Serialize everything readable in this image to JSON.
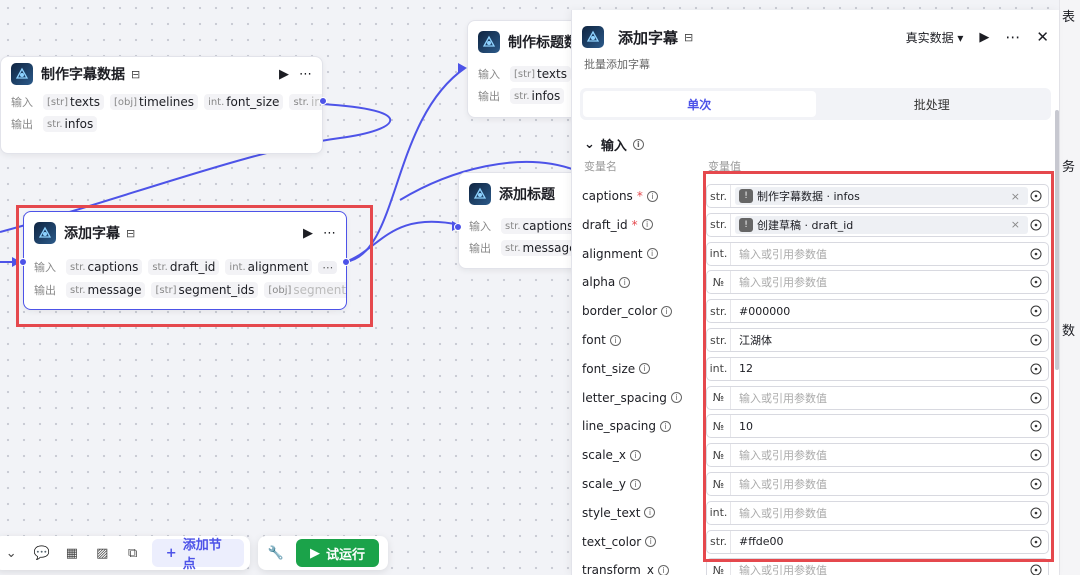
{
  "colors": {
    "accent": "#4d53e8",
    "run": "#1ba34a",
    "highlight": "#e5484d"
  },
  "nodes": {
    "make_subtitle": {
      "title": "制作字幕数据",
      "in_label": "输入",
      "out_label": "输出",
      "inputs": [
        {
          "type": "[str]",
          "name": "texts"
        },
        {
          "type": "[obj]",
          "name": "timelines"
        },
        {
          "type": "int.",
          "name": "font_size"
        },
        {
          "type": "str.",
          "name": "in"
        }
      ],
      "outputs": [
        {
          "type": "str.",
          "name": "infos"
        }
      ]
    },
    "add_subtitle": {
      "title": "添加字幕",
      "in_label": "输入",
      "out_label": "输出",
      "inputs": [
        {
          "type": "str.",
          "name": "captions"
        },
        {
          "type": "str.",
          "name": "draft_id"
        },
        {
          "type": "int.",
          "name": "alignment"
        }
      ],
      "outputs": [
        {
          "type": "str.",
          "name": "message"
        },
        {
          "type": "[str]",
          "name": "segment_ids"
        },
        {
          "type": "[obj]",
          "name": "segment"
        }
      ]
    },
    "make_title": {
      "title": "制作标题数",
      "in_label": "输入",
      "out_label": "输出",
      "inputs": [
        {
          "type": "[str]",
          "name": "texts"
        }
      ],
      "outputs": [
        {
          "type": "str.",
          "name": "infos"
        }
      ]
    },
    "add_title": {
      "title": "添加标题",
      "in_label": "输入",
      "out_label": "输出",
      "inputs": [
        {
          "type": "str.",
          "name": "captions"
        }
      ],
      "outputs": [
        {
          "type": "str.",
          "name": "message"
        }
      ]
    }
  },
  "toolbar": {
    "add_node": "添加节点",
    "test_run": "试运行"
  },
  "panel": {
    "title": "添加字幕",
    "subtitle": "批量添加字幕",
    "data_mode": "真实数据",
    "tabs": [
      {
        "label": "单次"
      },
      {
        "label": "批处理"
      }
    ],
    "section": "输入",
    "col_name": "变量名",
    "col_value": "变量值",
    "params": [
      {
        "name": "captions",
        "required": true,
        "type": "str.",
        "ref": true,
        "value": "制作字幕数据 · infos"
      },
      {
        "name": "draft_id",
        "required": true,
        "type": "str.",
        "ref": true,
        "value": "创建草稿 · draft_id"
      },
      {
        "name": "alignment",
        "required": false,
        "type": "int.",
        "ref": false,
        "value": "",
        "placeholder": "输入或引用参数值"
      },
      {
        "name": "alpha",
        "required": false,
        "type": "№",
        "ref": false,
        "value": "",
        "placeholder": "输入或引用参数值"
      },
      {
        "name": "border_color",
        "required": false,
        "type": "str.",
        "ref": false,
        "value": "#000000"
      },
      {
        "name": "font",
        "required": false,
        "type": "str.",
        "ref": false,
        "value": "江湖体"
      },
      {
        "name": "font_size",
        "required": false,
        "type": "int.",
        "ref": false,
        "value": "12"
      },
      {
        "name": "letter_spacing",
        "required": false,
        "type": "№",
        "ref": false,
        "value": "",
        "placeholder": "输入或引用参数值"
      },
      {
        "name": "line_spacing",
        "required": false,
        "type": "№",
        "ref": false,
        "value": "10"
      },
      {
        "name": "scale_x",
        "required": false,
        "type": "№",
        "ref": false,
        "value": "",
        "placeholder": "输入或引用参数值"
      },
      {
        "name": "scale_y",
        "required": false,
        "type": "№",
        "ref": false,
        "value": "",
        "placeholder": "输入或引用参数值"
      },
      {
        "name": "style_text",
        "required": false,
        "type": "int.",
        "ref": false,
        "value": "",
        "placeholder": "输入或引用参数值"
      },
      {
        "name": "text_color",
        "required": false,
        "type": "str.",
        "ref": false,
        "value": "#ffde00"
      },
      {
        "name": "transform_x",
        "required": false,
        "type": "№",
        "ref": false,
        "value": "",
        "placeholder": "输入或引用参数值"
      }
    ]
  },
  "right_strip": [
    "表",
    "务",
    "数"
  ]
}
